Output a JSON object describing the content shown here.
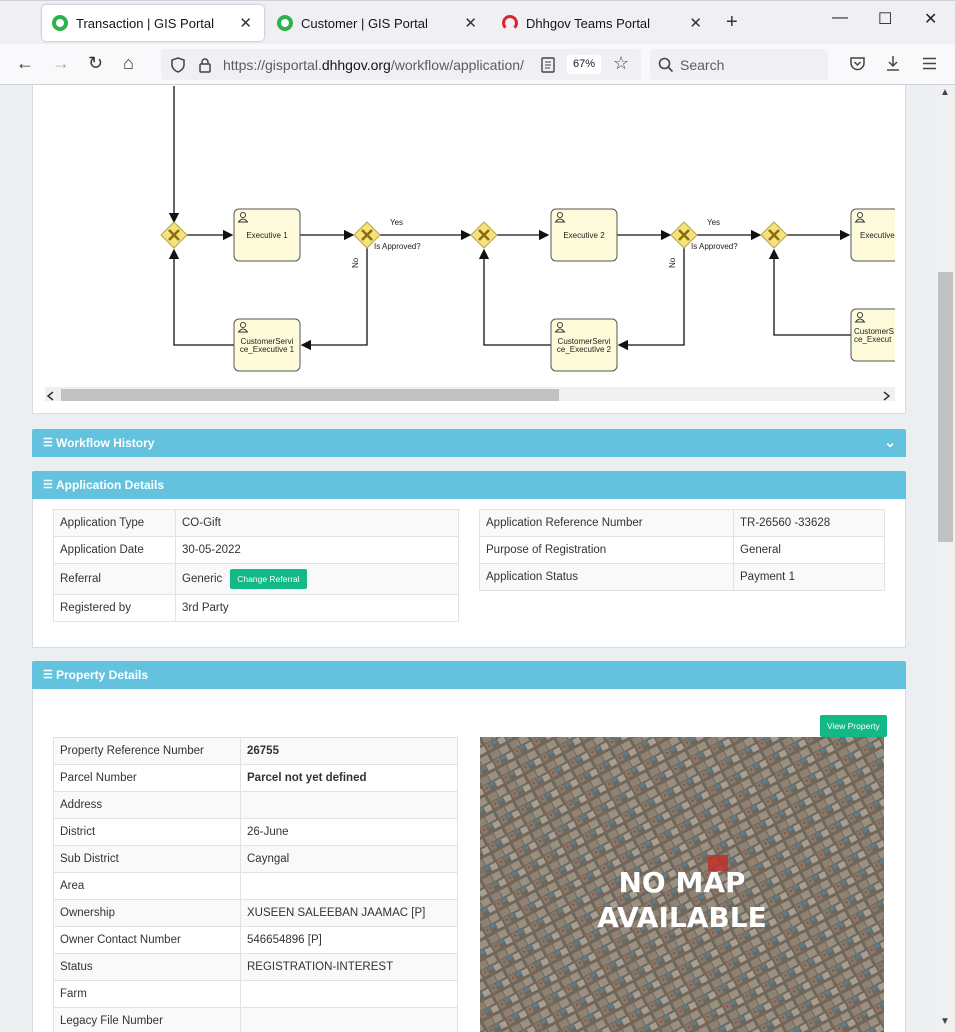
{
  "browser": {
    "tabs": [
      {
        "title": "Transaction | GIS Portal",
        "active": true
      },
      {
        "title": "Customer | GIS Portal",
        "active": false
      },
      {
        "title": "Dhhgov Teams Portal",
        "active": false
      }
    ],
    "url_prefix": "https://gisportal.",
    "url_domain": "dhhgov.org",
    "url_suffix": "/workflow/application/",
    "zoom": "67%",
    "search_placeholder": "Search"
  },
  "workflow": {
    "nodes": {
      "exec1": "Executive 1",
      "exec2": "Executive 2",
      "exec3": "Executive",
      "cs1_line1": "CustomerServi",
      "cs1_line2": "ce_Executive 1",
      "cs2_line1": "CustomerServi",
      "cs2_line2": "ce_Executive 2",
      "cs3_line1": "CustomerS",
      "cs3_line2": "ce_Execut"
    },
    "yes_label": "Yes",
    "no_label": "No",
    "decision_label": "Is Approved?"
  },
  "sections": {
    "workflow_history": "Workflow History",
    "application_details": "Application Details",
    "property_details": "Property Details"
  },
  "application": {
    "left": [
      {
        "label": "Application Type",
        "value": "CO-Gift"
      },
      {
        "label": "Application Date",
        "value": "30-05-2022"
      },
      {
        "label": "Referral",
        "value": "Generic"
      },
      {
        "label": "Registered by",
        "value": "3rd Party"
      }
    ],
    "right": [
      {
        "label": "Application Reference Number",
        "value": "TR-26560 -33628"
      },
      {
        "label": "Purpose of Registration",
        "value": "General"
      },
      {
        "label": "Application Status",
        "value": "Payment 1"
      }
    ],
    "change_referral_label": "Change Referral"
  },
  "property": {
    "view_property_label": "View Property",
    "rows": [
      {
        "label": "Property Reference Number",
        "value": "26755"
      },
      {
        "label": "Parcel Number",
        "value": "Parcel not yet defined"
      },
      {
        "label": "Address",
        "value": ""
      },
      {
        "label": "District",
        "value": "26-June"
      },
      {
        "label": "Sub District",
        "value": "Cayngal"
      },
      {
        "label": "Area",
        "value": ""
      },
      {
        "label": "Ownership",
        "value": "XUSEEN SALEEBAN JAAMAC [P]"
      },
      {
        "label": "Owner Contact Number",
        "value": "546654896 [P]"
      },
      {
        "label": "Status",
        "value": "REGISTRATION-INTEREST"
      },
      {
        "label": "Farm",
        "value": ""
      },
      {
        "label": "Legacy File Number",
        "value": ""
      }
    ],
    "map_text_line1": "NO MAP",
    "map_text_line2": "AVAILABLE"
  },
  "colors": {
    "panel_header": "#63c3de",
    "button_green": "#12b886",
    "task_fill": "#fdfbd9",
    "gateway_fill": "#f5e27a"
  }
}
